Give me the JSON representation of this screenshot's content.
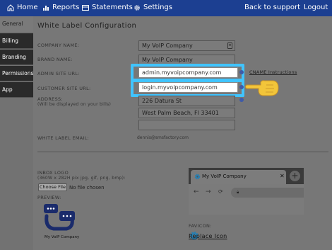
{
  "nav": {
    "home": "Home",
    "reports": "Reports",
    "statements": "Statements",
    "settings": "Settings",
    "back": "Back to support",
    "logout": "Logout"
  },
  "sidebar": {
    "items": [
      {
        "label": "General"
      },
      {
        "label": "Billing"
      },
      {
        "label": "Branding"
      },
      {
        "label": "Permissions"
      },
      {
        "label": "App"
      }
    ]
  },
  "page": {
    "title": "White Label Configuration",
    "company_name_label": "COMPANY NAME:",
    "company_name_value": "My VoIP Company",
    "brand_name_label": "BRAND NAME:",
    "brand_name_value": "My VoIP Company",
    "admin_url_label": "ADMIN SITE URL:",
    "admin_url_value": "admin.myvoipcompany.com",
    "cname_link": "CNAME Instructions",
    "customer_url_label": "CUSTOMER SITE URL:",
    "customer_url_value": "login.myvoipcompany.com",
    "address_label": "ADDRESS:",
    "address_sublabel": "(Will be displayed on your bills)",
    "address_line1": "226 Datura St",
    "address_line2": "West Palm Beach, Fl 33401",
    "address_line3": "",
    "email_label": "WHITE LABEL EMAIL:",
    "email_value": "dennis@smsfactory.com",
    "inbox_logo_label": "INBOX LOGO",
    "inbox_logo_hint": "(360W x 282H pix jpg, gif, png, bmp):",
    "choose_file": "Choose File",
    "no_file": "No file chosen",
    "preview_label": "PREVIEW:",
    "logo_caption": "My VoIP Company",
    "browser_tab_title": "My VoIP Company",
    "favicon_label": "FAVICON:",
    "replace_icon": "Replace Icon"
  },
  "colors": {
    "topbar": "#1c3f91",
    "highlight_border": "#40c4ff",
    "favicon": "#2a7fb0",
    "logo_navy": "#1a2b6b"
  }
}
